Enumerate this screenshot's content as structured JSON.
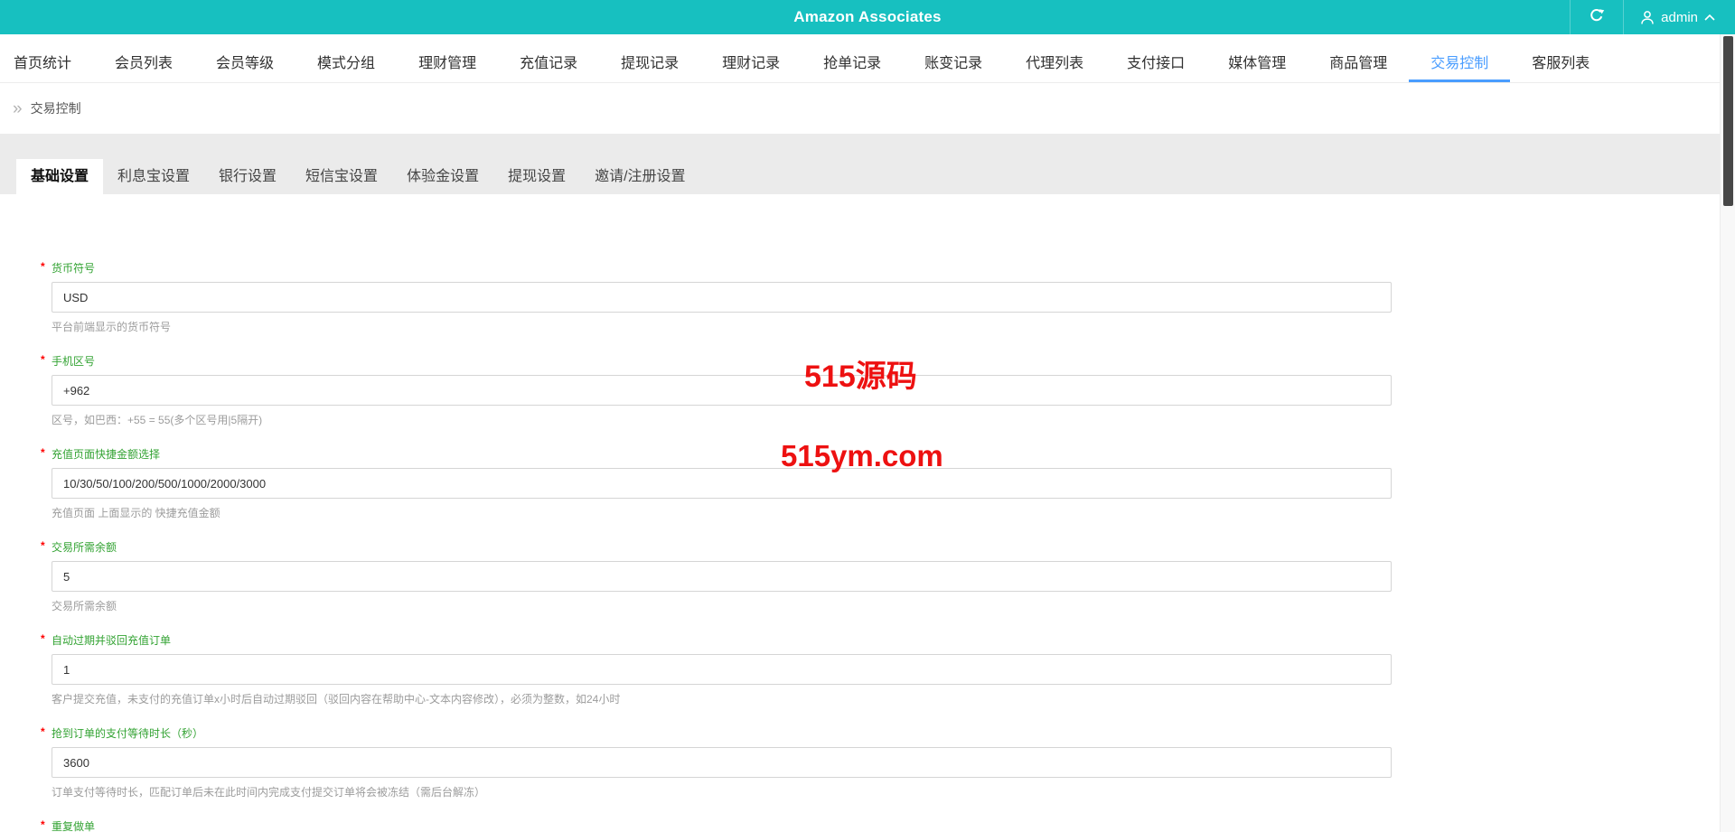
{
  "header": {
    "title": "Amazon Associates",
    "username": "admin",
    "accent_color": "#17c0c0"
  },
  "nav": {
    "active_color": "#4a9dff",
    "items": [
      "首页统计",
      "会员列表",
      "会员等级",
      "模式分组",
      "理财管理",
      "充值记录",
      "提现记录",
      "理财记录",
      "抢单记录",
      "账变记录",
      "代理列表",
      "支付接口",
      "媒体管理",
      "商品管理",
      "交易控制",
      "客服列表"
    ],
    "active_item": "交易控制"
  },
  "breadcrumb": {
    "icon": "»",
    "label": "交易控制"
  },
  "tabs": {
    "items": [
      "基础设置",
      "利息宝设置",
      "银行设置",
      "短信宝设置",
      "体验金设置",
      "提现设置",
      "邀请/注册设置"
    ],
    "active_item": "基础设置"
  },
  "form": {
    "label_color": "#33a333",
    "required_marker": "*",
    "fields": [
      {
        "label": "货币符号",
        "value": "USD",
        "help": "平台前端显示的货币符号"
      },
      {
        "label": "手机区号",
        "value": "+962",
        "help": "区号，如巴西：+55 = 55(多个区号用|5隔开)"
      },
      {
        "label": "充值页面快捷金额选择",
        "value": "10/30/50/100/200/500/1000/2000/3000",
        "help": "充值页面 上面显示的 快捷充值金额"
      },
      {
        "label": "交易所需余额",
        "value": "5",
        "help": "交易所需余额"
      },
      {
        "label": "自动过期并驳回充值订单",
        "value": "1",
        "help": "客户提交充值，未支付的充值订单x小时后自动过期驳回（驳回内容在帮助中心-文本内容修改），必须为整数，如24小时"
      },
      {
        "label": "抢到订单的支付等待时长（秒）",
        "value": "3600",
        "help": "订单支付等待时长，匹配订单后未在此时间内完成支付提交订单将会被冻结（需后台解冻）"
      },
      {
        "label": "重复做单",
        "value": "",
        "help": ""
      }
    ]
  },
  "watermark": {
    "line1": "515源码",
    "line2": "515ym.com",
    "color": "#ed1111"
  }
}
